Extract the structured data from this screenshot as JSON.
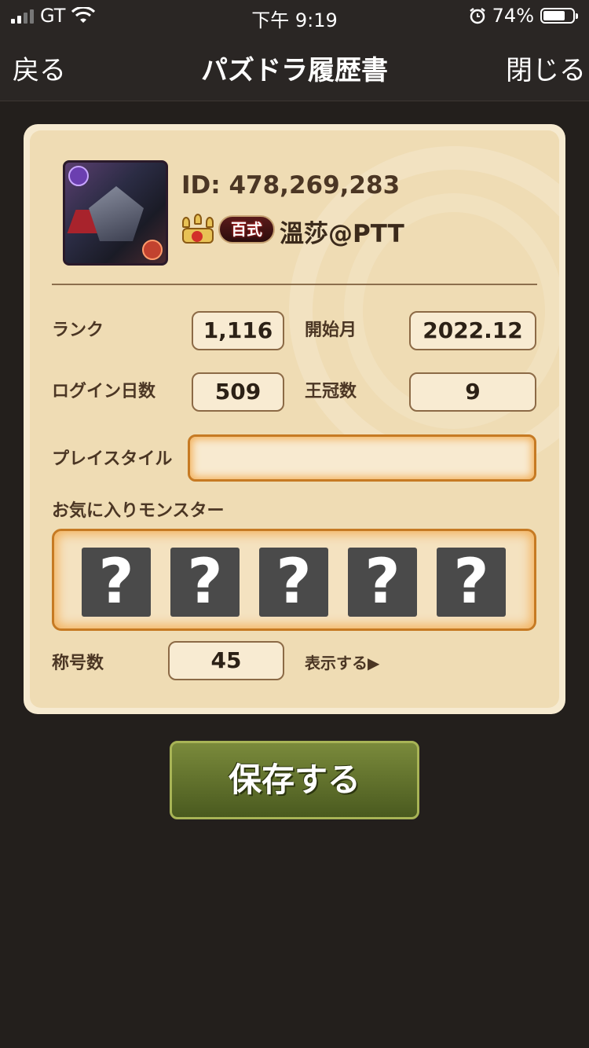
{
  "status_bar": {
    "carrier": "GT",
    "time": "下午 9:19",
    "battery": "74%",
    "battery_level": 0.74
  },
  "nav": {
    "back_label": "戻る",
    "title": "パズドラ履歴書",
    "close_label": "閉じる"
  },
  "profile": {
    "id_text": "ID: 478,269,283",
    "title_badge": "百式",
    "player_name": "溫莎@PTT"
  },
  "stats": {
    "rank_label": "ランク",
    "rank_value": "1,116",
    "start_label": "開始月",
    "start_value": "2022.12",
    "login_label": "ログイン日数",
    "login_value": "509",
    "crown_label": "王冠数",
    "crown_value": "9",
    "playstyle_label": "プレイスタイル",
    "playstyle_value": "",
    "favorites_label": "お気に入りモンスター",
    "favorite_slots": [
      "?",
      "?",
      "?",
      "?",
      "?"
    ],
    "titles_label": "称号数",
    "titles_value": "45",
    "show_more_label": "表示する▶"
  },
  "actions": {
    "save_label": "保存する"
  }
}
